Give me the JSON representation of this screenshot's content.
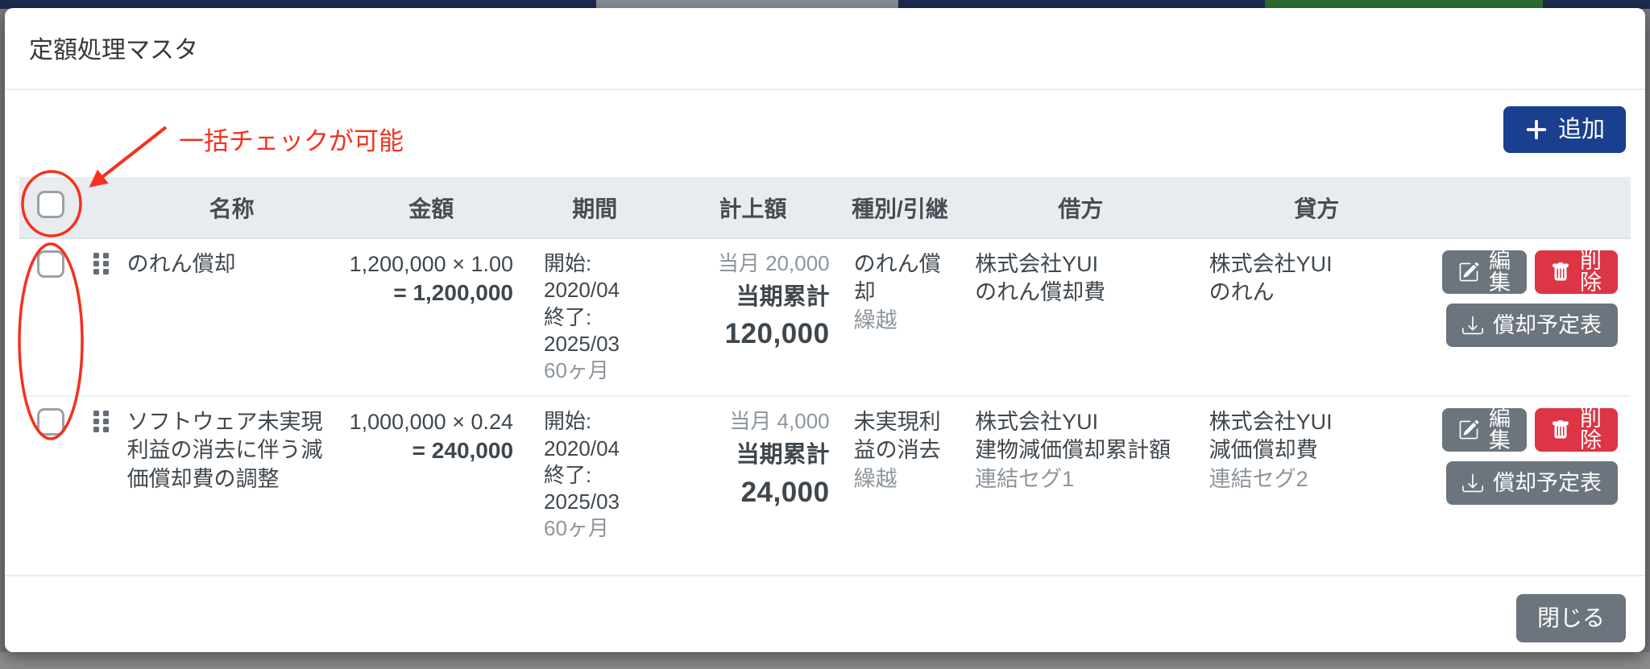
{
  "modal": {
    "title": "定額処理マスタ",
    "annotation": "一括チェックが可能",
    "buttons": {
      "add": "追加",
      "close": "閉じる",
      "edit": "編集",
      "delete": "削除",
      "schedule": "償却予定表"
    },
    "colors": {
      "primary": "#1a3f8e",
      "danger": "#dc3545",
      "secondary": "#6c757d",
      "annotation_red": "#f5301e",
      "header_bg": "#e9ecef"
    }
  },
  "table": {
    "headers": {
      "name": "名称",
      "amount": "金額",
      "period": "期間",
      "recorded": "計上額",
      "type": "種別/引継",
      "debit": "借方",
      "credit": "貸方"
    },
    "rows": [
      {
        "name": "のれん償却",
        "amount_formula": "1,200,000 × 1.00",
        "amount_total": "= 1,200,000",
        "period": {
          "start_label": "開始:",
          "start": "2020/04",
          "end_label": "終了:",
          "end": "2025/03",
          "months": "60ヶ月"
        },
        "recorded": {
          "monthly": "当月 20,000",
          "cumulative_label": "当期累計",
          "cumulative": "120,000"
        },
        "type": "のれん償却",
        "carryover": "繰越",
        "debit": {
          "company": "株式会社YUI",
          "account": "のれん償却費"
        },
        "credit": {
          "company": "株式会社YUI",
          "account": "のれん"
        }
      },
      {
        "name": "ソフトウェア未実現利益の消去に伴う減価償却費の調整",
        "amount_formula": "1,000,000 × 0.24",
        "amount_total": "= 240,000",
        "period": {
          "start_label": "開始:",
          "start": "2020/04",
          "end_label": "終了:",
          "end": "2025/03",
          "months": "60ヶ月"
        },
        "recorded": {
          "monthly": "当月 4,000",
          "cumulative_label": "当期累計",
          "cumulative": "24,000"
        },
        "type": "未実現利益の消去",
        "carryover": "繰越",
        "debit": {
          "company": "株式会社YUI",
          "account": "建物減価償却累計額",
          "segment": "連結セグ1"
        },
        "credit": {
          "company": "株式会社YUI",
          "account": "減価償却費",
          "segment": "連結セグ2"
        }
      }
    ]
  }
}
